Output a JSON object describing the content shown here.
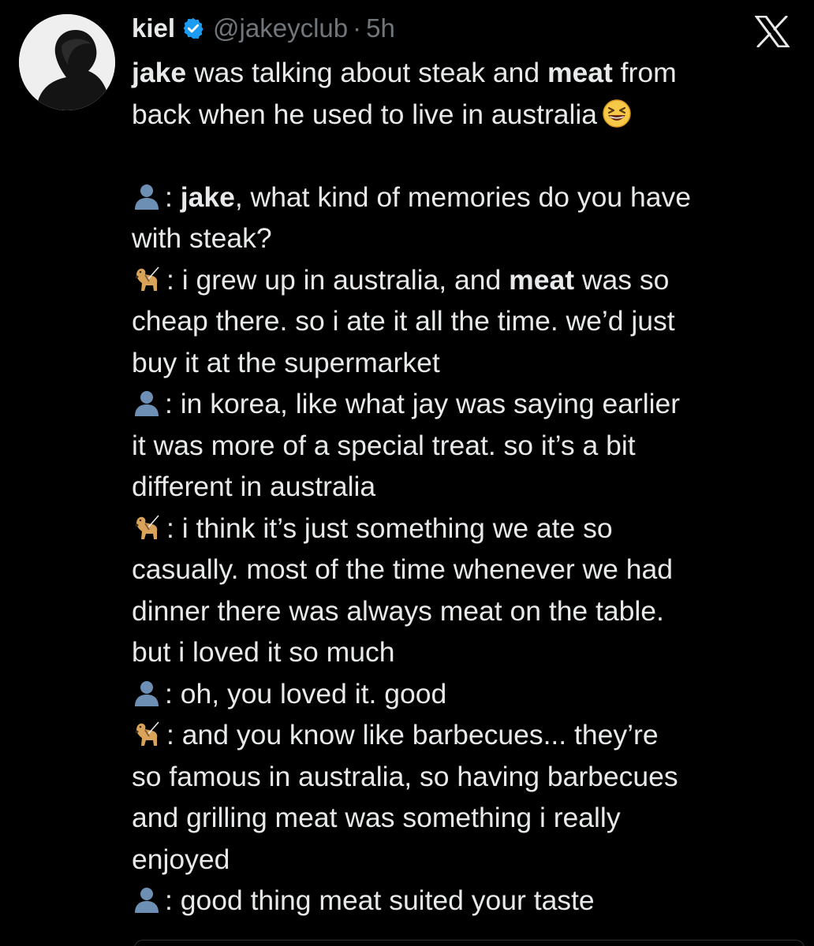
{
  "author": {
    "display_name": "kiel",
    "handle": "@jakeyclub",
    "separator": "·",
    "time": "5h",
    "verified": true,
    "avatar_icon": "profile-photo"
  },
  "platform_icon": "x-logo-icon",
  "colors": {
    "background": "#000000",
    "text": "#e7e9ea",
    "secondary_text": "#71767b",
    "verified_blue": "#1d9bf0"
  },
  "tweet": {
    "intro": {
      "l1_bold": "jake",
      "l1_rest": " was talking about steak and ",
      "l1_bold2": "meat",
      "l1_end": " from",
      "l2": "back when he used to live in australia",
      "emoji": "grinning-squinting-face"
    },
    "lines": [
      {
        "speaker": "user",
        "bold": "jake",
        "text_before": ": ",
        "text_after": ", what kind of memories do you have"
      },
      {
        "text": "with steak?"
      },
      {
        "speaker": "dog",
        "text_before": ": i grew up in australia, and ",
        "bold": "meat",
        "text_after": " was so"
      },
      {
        "text": "cheap there. so i ate it all the time. we’d just"
      },
      {
        "text": "buy it at the supermarket"
      },
      {
        "speaker": "user",
        "text": ": in korea, like what jay was saying earlier"
      },
      {
        "text": "it was more of a special treat. so it’s a bit"
      },
      {
        "text": "different in australia"
      },
      {
        "speaker": "dog",
        "text": ": i think it’s just something we ate so"
      },
      {
        "text": "casually. most of the time whenever we had"
      },
      {
        "text": "dinner there was always meat on the table."
      },
      {
        "text": "but i loved it so much"
      },
      {
        "speaker": "user",
        "text": ": oh, you loved it. good"
      },
      {
        "speaker": "dog",
        "text": ": and you know like barbecues... they’re"
      },
      {
        "text": "so famous in australia, so having barbecues"
      },
      {
        "text": "and grilling meat was something i really"
      },
      {
        "text": "enjoyed"
      },
      {
        "speaker": "user",
        "text": ": good thing meat suited your taste"
      }
    ]
  }
}
